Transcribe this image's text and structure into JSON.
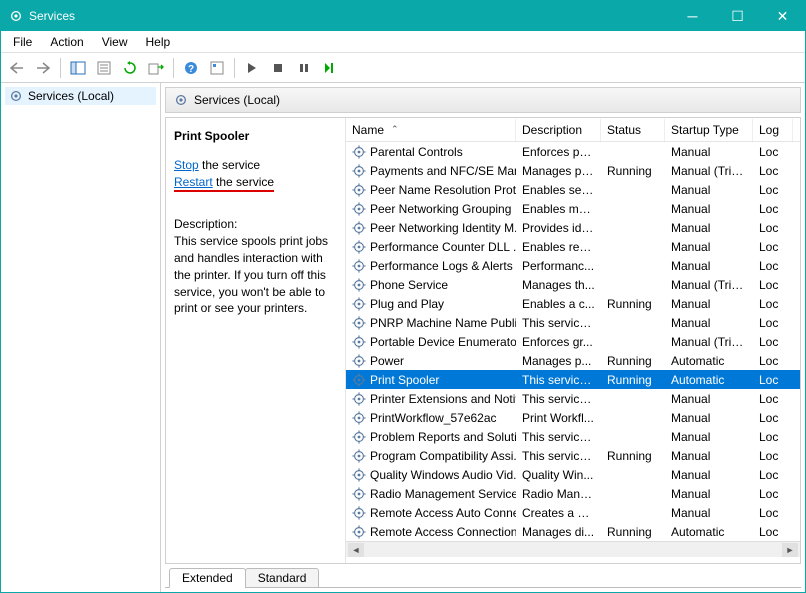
{
  "window": {
    "title": "Services"
  },
  "menubar": {
    "file": "File",
    "action": "Action",
    "view": "View",
    "help": "Help"
  },
  "tree": {
    "root": "Services (Local)"
  },
  "pane_header": "Services (Local)",
  "detail": {
    "title": "Print Spooler",
    "stop_link": "Stop",
    "stop_suffix": " the service",
    "restart_link": "Restart",
    "restart_suffix": " the service",
    "desc_label": "Description:",
    "desc_text": "This service spools print jobs and handles interaction with the printer. If you turn off this service, you won't be able to print or see your printers."
  },
  "columns": {
    "name": "Name",
    "desc": "Description",
    "status": "Status",
    "startup": "Startup Type",
    "logon": "Log"
  },
  "rows": [
    {
      "name": "Parental Controls",
      "desc": "Enforces pa...",
      "status": "",
      "startup": "Manual",
      "logon": "Loc"
    },
    {
      "name": "Payments and NFC/SE Man...",
      "desc": "Manages pa...",
      "status": "Running",
      "startup": "Manual (Trig...",
      "logon": "Loc"
    },
    {
      "name": "Peer Name Resolution Prot...",
      "desc": "Enables serv...",
      "status": "",
      "startup": "Manual",
      "logon": "Loc"
    },
    {
      "name": "Peer Networking Grouping",
      "desc": "Enables mul...",
      "status": "",
      "startup": "Manual",
      "logon": "Loc"
    },
    {
      "name": "Peer Networking Identity M...",
      "desc": "Provides ide...",
      "status": "",
      "startup": "Manual",
      "logon": "Loc"
    },
    {
      "name": "Performance Counter DLL ...",
      "desc": "Enables rem...",
      "status": "",
      "startup": "Manual",
      "logon": "Loc"
    },
    {
      "name": "Performance Logs & Alerts",
      "desc": "Performanc...",
      "status": "",
      "startup": "Manual",
      "logon": "Loc"
    },
    {
      "name": "Phone Service",
      "desc": "Manages th...",
      "status": "",
      "startup": "Manual (Trig...",
      "logon": "Loc"
    },
    {
      "name": "Plug and Play",
      "desc": "Enables a c...",
      "status": "Running",
      "startup": "Manual",
      "logon": "Loc"
    },
    {
      "name": "PNRP Machine Name Publi...",
      "desc": "This service ...",
      "status": "",
      "startup": "Manual",
      "logon": "Loc"
    },
    {
      "name": "Portable Device Enumerator...",
      "desc": "Enforces gr...",
      "status": "",
      "startup": "Manual (Trig...",
      "logon": "Loc"
    },
    {
      "name": "Power",
      "desc": "Manages p...",
      "status": "Running",
      "startup": "Automatic",
      "logon": "Loc"
    },
    {
      "name": "Print Spooler",
      "desc": "This service ...",
      "status": "Running",
      "startup": "Automatic",
      "logon": "Loc",
      "selected": true
    },
    {
      "name": "Printer Extensions and Notif...",
      "desc": "This service ...",
      "status": "",
      "startup": "Manual",
      "logon": "Loc"
    },
    {
      "name": "PrintWorkflow_57e62ac",
      "desc": "Print Workfl...",
      "status": "",
      "startup": "Manual",
      "logon": "Loc"
    },
    {
      "name": "Problem Reports and Soluti...",
      "desc": "This service ...",
      "status": "",
      "startup": "Manual",
      "logon": "Loc"
    },
    {
      "name": "Program Compatibility Assi...",
      "desc": "This service ...",
      "status": "Running",
      "startup": "Manual",
      "logon": "Loc"
    },
    {
      "name": "Quality Windows Audio Vid...",
      "desc": "Quality Win...",
      "status": "",
      "startup": "Manual",
      "logon": "Loc"
    },
    {
      "name": "Radio Management Service",
      "desc": "Radio Mana...",
      "status": "",
      "startup": "Manual",
      "logon": "Loc"
    },
    {
      "name": "Remote Access Auto Conne...",
      "desc": "Creates a co...",
      "status": "",
      "startup": "Manual",
      "logon": "Loc"
    },
    {
      "name": "Remote Access Connection...",
      "desc": "Manages di...",
      "status": "Running",
      "startup": "Automatic",
      "logon": "Loc"
    }
  ],
  "tabs": {
    "extended": "Extended",
    "standard": "Standard"
  }
}
